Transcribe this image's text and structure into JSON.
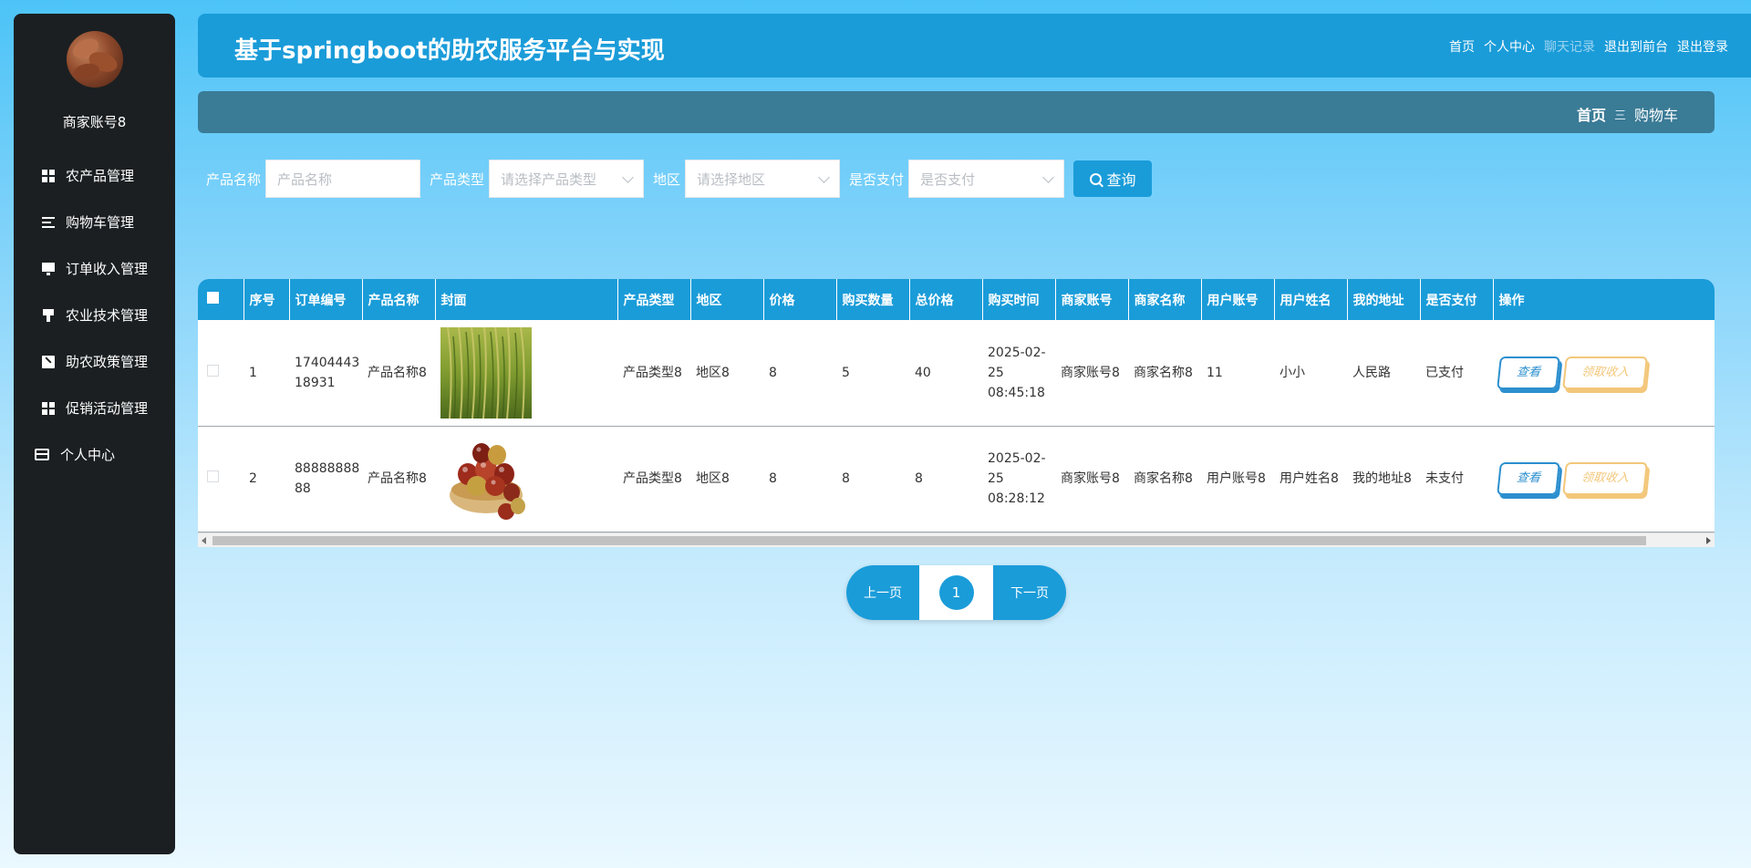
{
  "sidebar": {
    "username": "商家账号8",
    "items": [
      {
        "label": "农产品管理",
        "icon": "grid-icon"
      },
      {
        "label": "购物车管理",
        "icon": "list-icon"
      },
      {
        "label": "订单收入管理",
        "icon": "monitor-icon"
      },
      {
        "label": "农业技术管理",
        "icon": "cup-icon"
      },
      {
        "label": "助农政策管理",
        "icon": "document-icon"
      },
      {
        "label": "促销活动管理",
        "icon": "grid-icon"
      },
      {
        "label": "个人中心",
        "icon": "card-icon"
      }
    ]
  },
  "header": {
    "title": "基于springboot的助农服务平台与实现",
    "links": [
      "首页",
      "个人中心",
      "聊天记录",
      "退出到前台",
      "退出登录"
    ]
  },
  "breadcrumb": {
    "home": "首页",
    "separator": "三",
    "current": "购物车"
  },
  "search": {
    "fields": [
      {
        "label": "产品名称",
        "placeholder": "产品名称"
      },
      {
        "label": "产品类型",
        "placeholder": "请选择产品类型"
      },
      {
        "label": "地区",
        "placeholder": "请选择地区"
      },
      {
        "label": "是否支付",
        "placeholder": "是否支付"
      }
    ],
    "button": "查询"
  },
  "table": {
    "columns": [
      "序号",
      "订单编号",
      "产品名称",
      "封面",
      "产品类型",
      "地区",
      "价格",
      "购买数量",
      "总价格",
      "购买时间",
      "商家账号",
      "商家名称",
      "用户账号",
      "用户姓名",
      "我的地址",
      "是否支付",
      "操作"
    ],
    "rows": [
      {
        "index": "1",
        "order_no": "1740444318931",
        "product": "产品名称8",
        "cover": "rice-image",
        "type": "产品类型8",
        "region": "地区8",
        "price": "8",
        "qty": "5",
        "total": "40",
        "time": "2025-02-25 08:45:18",
        "merchant_account": "商家账号8",
        "merchant_name": "商家名称8",
        "user_account": "11",
        "user_name": "小小",
        "address": "人民路",
        "paid": "已支付"
      },
      {
        "index": "2",
        "order_no": "8888888888",
        "product": "产品名称8",
        "cover": "jujube-image",
        "type": "产品类型8",
        "region": "地区8",
        "price": "8",
        "qty": "8",
        "total": "8",
        "time": "2025-02-25 08:28:12",
        "merchant_account": "商家账号8",
        "merchant_name": "商家名称8",
        "user_account": "用户账号8",
        "user_name": "用户姓名8",
        "address": "我的地址8",
        "paid": "未支付"
      }
    ],
    "actions": {
      "view": "查看",
      "income": "领取收入"
    }
  },
  "pager": {
    "prev": "上一页",
    "current": "1",
    "next": "下一页"
  },
  "colors": {
    "primary": "#1a9cd9",
    "sidebar": "#1b1f22",
    "crumbbar": "#3a7b96",
    "income": "#f3c77a"
  }
}
